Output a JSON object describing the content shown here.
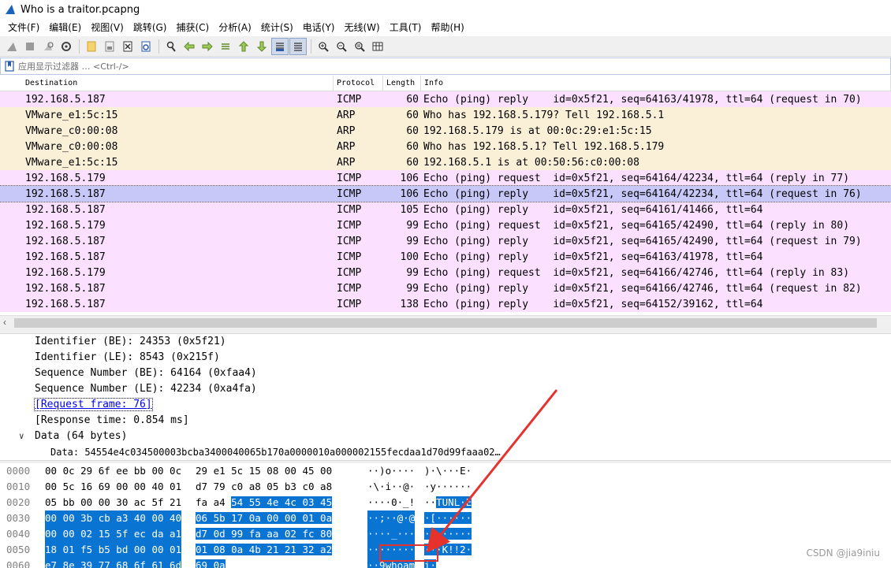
{
  "window": {
    "title": "Who is a traitor.pcapng"
  },
  "menu": [
    "文件(F)",
    "编辑(E)",
    "视图(V)",
    "跳转(G)",
    "捕获(C)",
    "分析(A)",
    "统计(S)",
    "电话(Y)",
    "无线(W)",
    "工具(T)",
    "帮助(H)"
  ],
  "filter": {
    "placeholder": "应用显示过滤器 … <Ctrl-/>"
  },
  "packet_list": {
    "columns": [
      "Destination",
      "Protocol",
      "Length",
      "Info"
    ],
    "rows": [
      {
        "dst": "192.168.5.187",
        "proto": "ICMP",
        "len": "60",
        "info": "Echo (ping) reply    id=0x5f21, seq=64163/41978, ttl=64 (request in 70)",
        "type": "icmp"
      },
      {
        "dst": "VMware_e1:5c:15",
        "proto": "ARP",
        "len": "60",
        "info": "Who has 192.168.5.179? Tell 192.168.5.1",
        "type": "arp"
      },
      {
        "dst": "VMware_c0:00:08",
        "proto": "ARP",
        "len": "60",
        "info": "192.168.5.179 is at 00:0c:29:e1:5c:15",
        "type": "arp"
      },
      {
        "dst": "VMware_c0:00:08",
        "proto": "ARP",
        "len": "60",
        "info": "Who has 192.168.5.1? Tell 192.168.5.179",
        "type": "arp"
      },
      {
        "dst": "VMware_e1:5c:15",
        "proto": "ARP",
        "len": "60",
        "info": "192.168.5.1 is at 00:50:56:c0:00:08",
        "type": "arp"
      },
      {
        "dst": "192.168.5.179",
        "proto": "ICMP",
        "len": "106",
        "info": "Echo (ping) request  id=0x5f21, seq=64164/42234, ttl=64 (reply in 77)",
        "type": "icmp"
      },
      {
        "dst": "192.168.5.187",
        "proto": "ICMP",
        "len": "106",
        "info": "Echo (ping) reply    id=0x5f21, seq=64164/42234, ttl=64 (request in 76)",
        "type": "selected"
      },
      {
        "dst": "192.168.5.187",
        "proto": "ICMP",
        "len": "105",
        "info": "Echo (ping) reply    id=0x5f21, seq=64161/41466, ttl=64",
        "type": "icmp"
      },
      {
        "dst": "192.168.5.179",
        "proto": "ICMP",
        "len": "99",
        "info": "Echo (ping) request  id=0x5f21, seq=64165/42490, ttl=64 (reply in 80)",
        "type": "icmp"
      },
      {
        "dst": "192.168.5.187",
        "proto": "ICMP",
        "len": "99",
        "info": "Echo (ping) reply    id=0x5f21, seq=64165/42490, ttl=64 (request in 79)",
        "type": "icmp"
      },
      {
        "dst": "192.168.5.187",
        "proto": "ICMP",
        "len": "100",
        "info": "Echo (ping) reply    id=0x5f21, seq=64163/41978, ttl=64",
        "type": "icmp"
      },
      {
        "dst": "192.168.5.179",
        "proto": "ICMP",
        "len": "99",
        "info": "Echo (ping) request  id=0x5f21, seq=64166/42746, ttl=64 (reply in 83)",
        "type": "icmp"
      },
      {
        "dst": "192.168.5.187",
        "proto": "ICMP",
        "len": "99",
        "info": "Echo (ping) reply    id=0x5f21, seq=64166/42746, ttl=64 (request in 82)",
        "type": "icmp"
      },
      {
        "dst": "192.168.5.187",
        "proto": "ICMP",
        "len": "138",
        "info": "Echo (ping) reply    id=0x5f21, seq=64152/39162, ttl=64",
        "type": "icmp"
      }
    ]
  },
  "details": {
    "identifier_be": "Identifier (BE): 24353 (0x5f21)",
    "identifier_le": "Identifier (LE): 8543 (0x215f)",
    "seq_be": "Sequence Number (BE): 64164 (0xfaa4)",
    "seq_le": "Sequence Number (LE): 42234 (0xa4fa)",
    "request_frame": "[Request frame: 76]",
    "response_time": "[Response time: 0.854 ms]",
    "data_node": "Data (64 bytes)",
    "data_value": "Data: 54554e4c034500003bcba3400040065b170a0000010a000002155fecdaa1d70d99faaa02…"
  },
  "hex": [
    {
      "off": "0000",
      "ha": "00 0c 29 6f ee bb 00 0c",
      "hb": "29 e1 5c 15 08 00 45 00",
      "hb_hl": "",
      "hb_tail": "",
      "aa": "··)o····",
      "ab": ")·\\···E·",
      "ab_hl": "",
      "full_hl": false
    },
    {
      "off": "0010",
      "ha": "00 5c 16 69 00 00 40 01",
      "hb": "d7 79 c0 a8 05 b3 c0 a8",
      "hb_hl": "",
      "hb_tail": "",
      "aa": "·\\·i··@·",
      "ab": "·y······",
      "ab_hl": "",
      "full_hl": false
    },
    {
      "off": "0020",
      "ha": "05 bb 00 00 30 ac 5f 21",
      "hb": "fa a4 ",
      "hb_hl": "54 55 4e 4c 03 45",
      "hb_tail": "",
      "aa": "····0·_!",
      "ab": "··",
      "ab_hl": "TUNL·E",
      "full_hl": false
    },
    {
      "off": "0030",
      "ha": "00 00 3b cb a3 40 00 40",
      "hb": "06 5b 17 0a 00 00 01 0a",
      "hb_hl": "",
      "hb_tail": "",
      "aa": "··;··@·@",
      "ab": "·[······",
      "ab_hl": "",
      "full_hl": true
    },
    {
      "off": "0040",
      "ha": "00 00 02 15 5f ec da a1",
      "hb": "d7 0d 99 fa aa 02 fc 80",
      "hb_hl": "",
      "hb_tail": "",
      "aa": "····_···",
      "ab": "········",
      "ab_hl": "",
      "full_hl": true
    },
    {
      "off": "0050",
      "ha": "18 01 f5 b5 bd 00 00 01",
      "hb": "01 08 0a 4b 21 21 32 a2",
      "hb_hl": "",
      "hb_tail": "",
      "aa": "········",
      "ab": "···K!!2·",
      "ab_hl": "",
      "full_hl": true
    },
    {
      "off": "0060",
      "ha": "e7 8e 39 77 68 6f 61 6d",
      "hb": "69 0a",
      "hb_hl": "",
      "hb_tail": "",
      "aa": "··9whoam",
      "ab": "i·",
      "ab_hl": "",
      "full_hl": true
    }
  ],
  "watermark": "CSDN @jia9iniu",
  "colors": {
    "icmp_row": "#fce0ff",
    "arp_row": "#faf0d7",
    "selected_row": "#c7c7f8",
    "hex_highlight": "#0a74d2",
    "annotation_red": "#e5322d"
  }
}
